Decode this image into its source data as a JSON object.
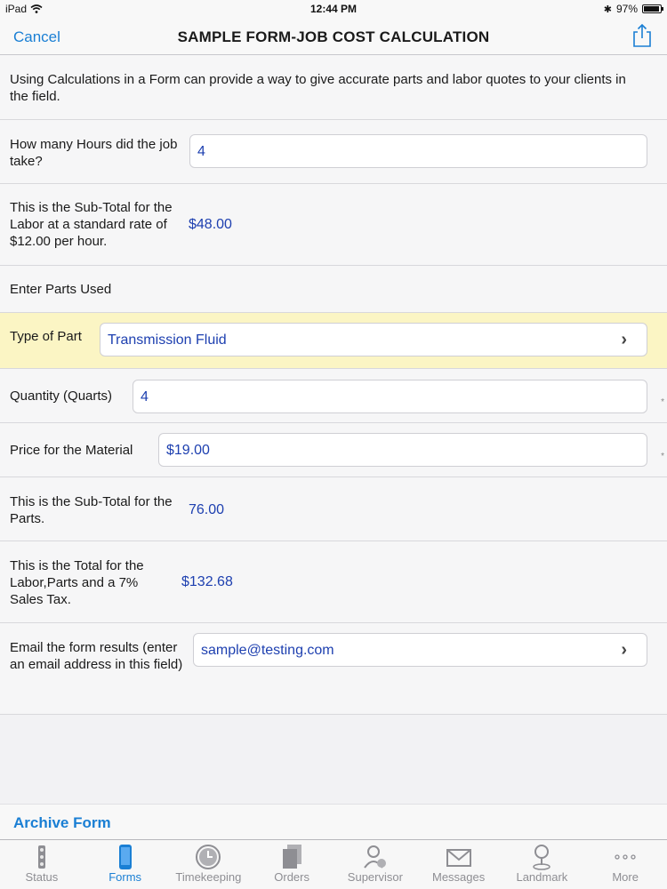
{
  "status_bar": {
    "device": "iPad",
    "time": "12:44 PM",
    "battery": "97%"
  },
  "nav": {
    "cancel": "Cancel",
    "title": "SAMPLE FORM-JOB COST CALCULATION"
  },
  "form": {
    "intro": "Using Calculations in a Form can provide a way to give accurate parts and labor quotes to your clients in the field.",
    "hours_label": "How many Hours did the job take?",
    "hours_value": "4",
    "labor_label": "This is the Sub-Total for the Labor at a standard rate of $12.00 per hour.",
    "labor_value": "$48.00",
    "parts_heading": "Enter Parts Used",
    "part_type_label": "Type of Part",
    "part_type_value": "Transmission Fluid",
    "quantity_label": "Quantity (Quarts)",
    "quantity_value": "4",
    "price_label": "Price for the Material",
    "price_value": "$19.00",
    "parts_subtotal_label": "This is the Sub-Total for the Parts.",
    "parts_subtotal_value": "76.00",
    "total_label": "This is the Total for the Labor,Parts and a 7% Sales Tax.",
    "total_value": "$132.68",
    "email_label": "Email the form results (enter an email address in this field)",
    "email_value": "sample@testing.com",
    "required_marker": "*"
  },
  "archive": "Archive Form",
  "tabs": [
    {
      "label": "Status",
      "icon": "traffic-light-icon"
    },
    {
      "label": "Forms",
      "icon": "phone-forms-icon",
      "active": true
    },
    {
      "label": "Timekeeping",
      "icon": "clock-icon"
    },
    {
      "label": "Orders",
      "icon": "documents-icon"
    },
    {
      "label": "Supervisor",
      "icon": "supervisor-icon"
    },
    {
      "label": "Messages",
      "icon": "envelope-icon"
    },
    {
      "label": "Landmark",
      "icon": "pin-icon"
    },
    {
      "label": "More",
      "icon": "more-dots-icon"
    }
  ],
  "colors": {
    "accent": "#1a7fd4",
    "value_text": "#1e40b0",
    "highlight_row": "#fbf5c4"
  }
}
